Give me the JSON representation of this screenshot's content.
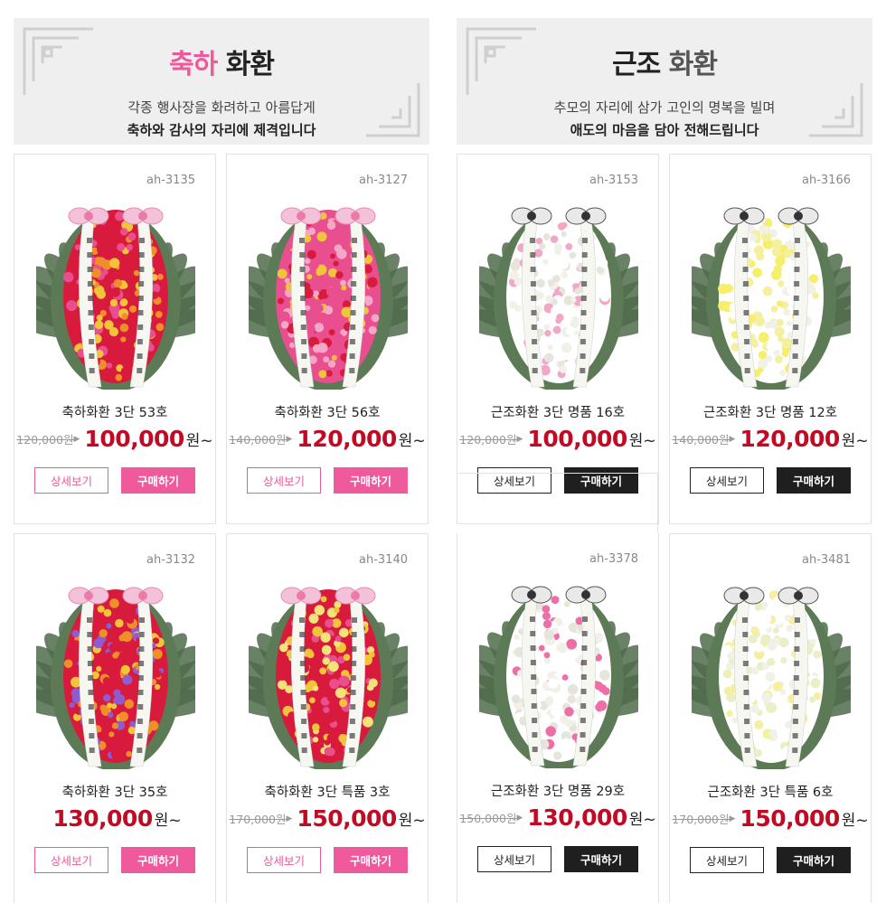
{
  "banners": {
    "celebration": {
      "title_accent": "축하",
      "title_rest": "화환",
      "line1": "각종 행사장을 화려하고 아름답게",
      "line2": "축하와 감사의 자리에 제격입니다"
    },
    "condolence": {
      "title_accent": "근조",
      "title_rest": "화환",
      "line1": "추모의 자리에 삼가 고인의 명복을 빌며",
      "line2": "애도의 마음을 담아 전해드립니다"
    }
  },
  "buttons": {
    "detail": "상세보기",
    "buy": "구매하기"
  },
  "currency_suffix": "원~",
  "products": [
    {
      "code": "ah-3135",
      "name": "축하화환 3단 53호",
      "old_price": "120,000원",
      "price": "100,000",
      "theme": "pink",
      "flowers": [
        "#d81b3c",
        "#f2c43a",
        "#e94f8f",
        "#f08f2a"
      ]
    },
    {
      "code": "ah-3127",
      "name": "축하화환 3단 56호",
      "old_price": "140,000원",
      "price": "120,000",
      "theme": "pink",
      "flowers": [
        "#e94f8f",
        "#f4a8c8",
        "#d81b3c",
        "#f2c43a"
      ]
    },
    {
      "code": "ah-3153",
      "name": "근조화환 3단 명품 16호",
      "old_price": "120,000원",
      "price": "100,000",
      "theme": "dark",
      "flowers": [
        "#ffffff",
        "#f1f1e8",
        "#f3a7c6",
        "#e5e5dc"
      ]
    },
    {
      "code": "ah-3166",
      "name": "근조화환 3단 명품 12호",
      "old_price": "140,000원",
      "price": "120,000",
      "theme": "dark",
      "flowers": [
        "#ffffff",
        "#f4f0a0",
        "#f1f1e8",
        "#f7ef6b"
      ]
    },
    {
      "code": "ah-3132",
      "name": "축하화환 3단 35호",
      "old_price": "",
      "price": "130,000",
      "theme": "pink",
      "flowers": [
        "#d81b3c",
        "#f2c43a",
        "#8e5bd0",
        "#f08f2a"
      ]
    },
    {
      "code": "ah-3140",
      "name": "축하화환 3단 특품 3호",
      "old_price": "170,000원",
      "price": "150,000",
      "theme": "pink",
      "flowers": [
        "#d81b3c",
        "#e94f8f",
        "#f2c43a",
        "#f6e27a"
      ]
    },
    {
      "code": "ah-3378",
      "name": "근조화환 3단 명품 29호",
      "old_price": "150,000원",
      "price": "130,000",
      "theme": "dark",
      "flowers": [
        "#ffffff",
        "#f1f1e8",
        "#ee6fa6",
        "#e5e5dc"
      ]
    },
    {
      "code": "ah-3481",
      "name": "근조화환 3단 특품 6호",
      "old_price": "170,000원",
      "price": "150,000",
      "theme": "dark",
      "flowers": [
        "#ffffff",
        "#e9efc9",
        "#f4f0a0",
        "#f1f1e8"
      ]
    }
  ],
  "colors": {
    "pink": "#ee5a9c",
    "price_red": "#c10b24",
    "dark": "#1f1f1f",
    "leaf": "#4f6b4a"
  }
}
